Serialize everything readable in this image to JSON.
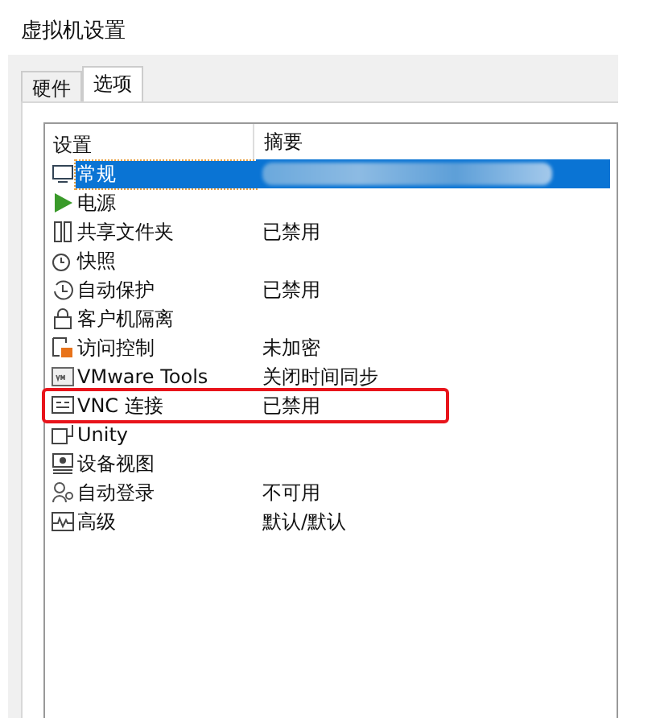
{
  "window": {
    "title": "虚拟机设置"
  },
  "tabs": [
    {
      "label": "硬件",
      "selected": false
    },
    {
      "label": "选项",
      "selected": true
    }
  ],
  "table": {
    "columns": [
      "设置",
      "摘要"
    ],
    "rows": [
      {
        "setting": "常规",
        "summary": "",
        "redacted": true,
        "selected": true,
        "highlighted": false
      },
      {
        "setting": "电源",
        "summary": "",
        "redacted": false,
        "selected": false,
        "highlighted": false
      },
      {
        "setting": "共享文件夹",
        "summary": "已禁用",
        "redacted": false,
        "selected": false,
        "highlighted": false
      },
      {
        "setting": "快照",
        "summary": "",
        "redacted": false,
        "selected": false,
        "highlighted": false
      },
      {
        "setting": "自动保护",
        "summary": "已禁用",
        "redacted": false,
        "selected": false,
        "highlighted": false
      },
      {
        "setting": "客户机隔离",
        "summary": "",
        "redacted": false,
        "selected": false,
        "highlighted": false
      },
      {
        "setting": "访问控制",
        "summary": "未加密",
        "redacted": false,
        "selected": false,
        "highlighted": false
      },
      {
        "setting": "VMware Tools",
        "summary": "关闭时间同步",
        "redacted": false,
        "selected": false,
        "highlighted": false
      },
      {
        "setting": "VNC 连接",
        "summary": "已禁用",
        "redacted": false,
        "selected": false,
        "highlighted": true
      },
      {
        "setting": "Unity",
        "summary": "",
        "redacted": false,
        "selected": false,
        "highlighted": false
      },
      {
        "setting": "设备视图",
        "summary": "",
        "redacted": false,
        "selected": false,
        "highlighted": false
      },
      {
        "setting": "自动登录",
        "summary": "不可用",
        "redacted": false,
        "selected": false,
        "highlighted": false
      },
      {
        "setting": "高级",
        "summary": "默认/默认",
        "redacted": false,
        "selected": false,
        "highlighted": false
      }
    ]
  }
}
